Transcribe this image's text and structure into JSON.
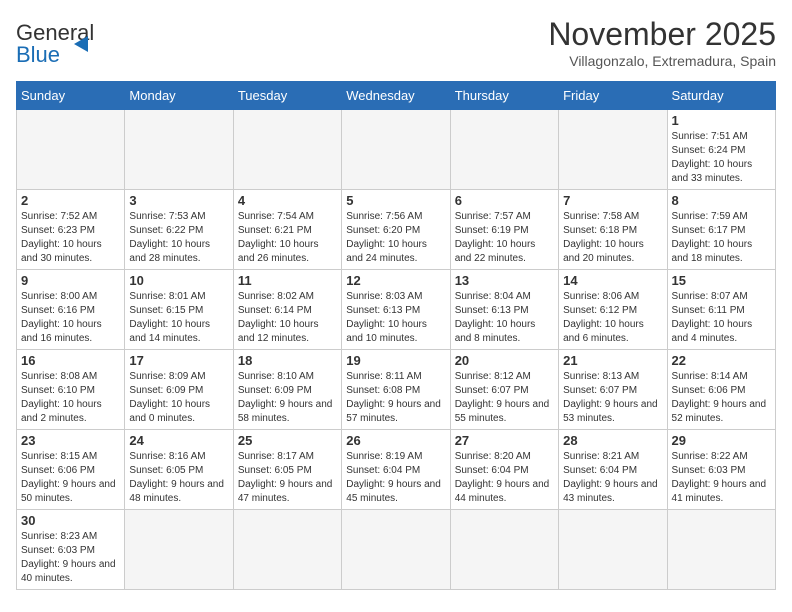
{
  "header": {
    "logo_general": "General",
    "logo_blue": "Blue",
    "month": "November 2025",
    "location": "Villagonzalo, Extremadura, Spain"
  },
  "weekdays": [
    "Sunday",
    "Monday",
    "Tuesday",
    "Wednesday",
    "Thursday",
    "Friday",
    "Saturday"
  ],
  "weeks": [
    [
      {
        "day": "",
        "empty": true
      },
      {
        "day": "",
        "empty": true
      },
      {
        "day": "",
        "empty": true
      },
      {
        "day": "",
        "empty": true
      },
      {
        "day": "",
        "empty": true
      },
      {
        "day": "",
        "empty": true
      },
      {
        "day": "1",
        "sunrise": "7:51 AM",
        "sunset": "6:24 PM",
        "daylight": "10 hours and 33 minutes."
      }
    ],
    [
      {
        "day": "2",
        "sunrise": "7:52 AM",
        "sunset": "6:23 PM",
        "daylight": "10 hours and 30 minutes."
      },
      {
        "day": "3",
        "sunrise": "7:53 AM",
        "sunset": "6:22 PM",
        "daylight": "10 hours and 28 minutes."
      },
      {
        "day": "4",
        "sunrise": "7:54 AM",
        "sunset": "6:21 PM",
        "daylight": "10 hours and 26 minutes."
      },
      {
        "day": "5",
        "sunrise": "7:56 AM",
        "sunset": "6:20 PM",
        "daylight": "10 hours and 24 minutes."
      },
      {
        "day": "6",
        "sunrise": "7:57 AM",
        "sunset": "6:19 PM",
        "daylight": "10 hours and 22 minutes."
      },
      {
        "day": "7",
        "sunrise": "7:58 AM",
        "sunset": "6:18 PM",
        "daylight": "10 hours and 20 minutes."
      },
      {
        "day": "8",
        "sunrise": "7:59 AM",
        "sunset": "6:17 PM",
        "daylight": "10 hours and 18 minutes."
      }
    ],
    [
      {
        "day": "9",
        "sunrise": "8:00 AM",
        "sunset": "6:16 PM",
        "daylight": "10 hours and 16 minutes."
      },
      {
        "day": "10",
        "sunrise": "8:01 AM",
        "sunset": "6:15 PM",
        "daylight": "10 hours and 14 minutes."
      },
      {
        "day": "11",
        "sunrise": "8:02 AM",
        "sunset": "6:14 PM",
        "daylight": "10 hours and 12 minutes."
      },
      {
        "day": "12",
        "sunrise": "8:03 AM",
        "sunset": "6:13 PM",
        "daylight": "10 hours and 10 minutes."
      },
      {
        "day": "13",
        "sunrise": "8:04 AM",
        "sunset": "6:13 PM",
        "daylight": "10 hours and 8 minutes."
      },
      {
        "day": "14",
        "sunrise": "8:06 AM",
        "sunset": "6:12 PM",
        "daylight": "10 hours and 6 minutes."
      },
      {
        "day": "15",
        "sunrise": "8:07 AM",
        "sunset": "6:11 PM",
        "daylight": "10 hours and 4 minutes."
      }
    ],
    [
      {
        "day": "16",
        "sunrise": "8:08 AM",
        "sunset": "6:10 PM",
        "daylight": "10 hours and 2 minutes."
      },
      {
        "day": "17",
        "sunrise": "8:09 AM",
        "sunset": "6:09 PM",
        "daylight": "10 hours and 0 minutes."
      },
      {
        "day": "18",
        "sunrise": "8:10 AM",
        "sunset": "6:09 PM",
        "daylight": "9 hours and 58 minutes."
      },
      {
        "day": "19",
        "sunrise": "8:11 AM",
        "sunset": "6:08 PM",
        "daylight": "9 hours and 57 minutes."
      },
      {
        "day": "20",
        "sunrise": "8:12 AM",
        "sunset": "6:07 PM",
        "daylight": "9 hours and 55 minutes."
      },
      {
        "day": "21",
        "sunrise": "8:13 AM",
        "sunset": "6:07 PM",
        "daylight": "9 hours and 53 minutes."
      },
      {
        "day": "22",
        "sunrise": "8:14 AM",
        "sunset": "6:06 PM",
        "daylight": "9 hours and 52 minutes."
      }
    ],
    [
      {
        "day": "23",
        "sunrise": "8:15 AM",
        "sunset": "6:06 PM",
        "daylight": "9 hours and 50 minutes."
      },
      {
        "day": "24",
        "sunrise": "8:16 AM",
        "sunset": "6:05 PM",
        "daylight": "9 hours and 48 minutes."
      },
      {
        "day": "25",
        "sunrise": "8:17 AM",
        "sunset": "6:05 PM",
        "daylight": "9 hours and 47 minutes."
      },
      {
        "day": "26",
        "sunrise": "8:19 AM",
        "sunset": "6:04 PM",
        "daylight": "9 hours and 45 minutes."
      },
      {
        "day": "27",
        "sunrise": "8:20 AM",
        "sunset": "6:04 PM",
        "daylight": "9 hours and 44 minutes."
      },
      {
        "day": "28",
        "sunrise": "8:21 AM",
        "sunset": "6:04 PM",
        "daylight": "9 hours and 43 minutes."
      },
      {
        "day": "29",
        "sunrise": "8:22 AM",
        "sunset": "6:03 PM",
        "daylight": "9 hours and 41 minutes."
      }
    ],
    [
      {
        "day": "30",
        "sunrise": "8:23 AM",
        "sunset": "6:03 PM",
        "daylight": "9 hours and 40 minutes."
      },
      {
        "day": "",
        "empty": true
      },
      {
        "day": "",
        "empty": true
      },
      {
        "day": "",
        "empty": true
      },
      {
        "day": "",
        "empty": true
      },
      {
        "day": "",
        "empty": true
      },
      {
        "day": "",
        "empty": true
      }
    ]
  ]
}
